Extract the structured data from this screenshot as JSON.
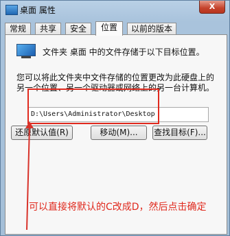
{
  "window": {
    "title": "桌面 属性",
    "close_label": "X"
  },
  "tabs": [
    {
      "label": "常规"
    },
    {
      "label": "共享"
    },
    {
      "label": "安全"
    },
    {
      "label": "位置"
    },
    {
      "label": "以前的版本"
    }
  ],
  "active_tab": "位置",
  "location": {
    "description": "文件夹 桌面 中的文件存储于以下目标位置。",
    "hint": "您可以将此文件夹中文件存储的位置更改为此硬盘上的另一个位置、另一个驱动器或网络上的另一台计算机。",
    "path_value": "D:\\Users\\Administrator\\Desktop"
  },
  "buttons": {
    "restore_default": "还原默认值(R)",
    "move": "移动(M)...",
    "find_target": "查找目标(F)..."
  },
  "annotation": {
    "text": "可以直接将默认的C改成D，然后点击确定",
    "color": "#e0291d"
  }
}
